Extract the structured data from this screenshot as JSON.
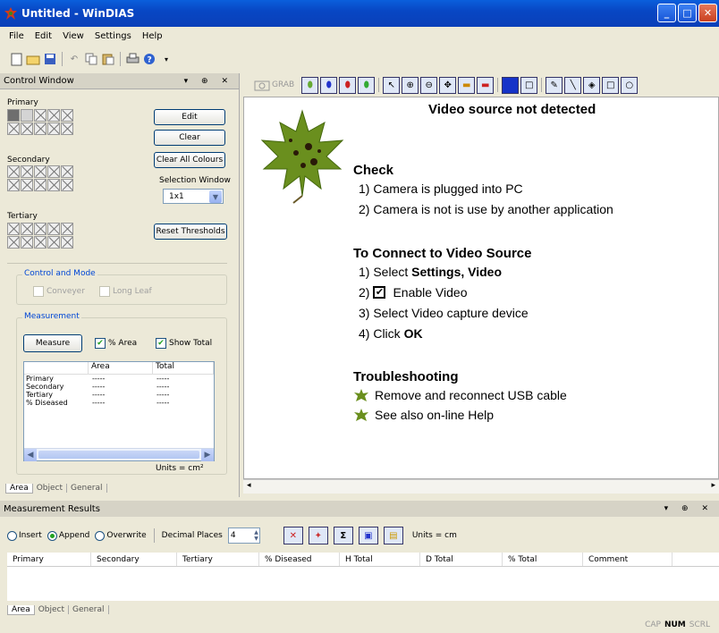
{
  "window": {
    "title": "Untitled - WinDIAS"
  },
  "menu": [
    "File",
    "Edit",
    "View",
    "Settings",
    "Help"
  ],
  "control": {
    "title": "Control Window",
    "primary": "Primary",
    "secondary": "Secondary",
    "tertiary": "Tertiary",
    "edit": "Edit",
    "clear": "Clear",
    "clear_all": "Clear All Colours",
    "selection_window": "Selection Window",
    "selection_value": "1x1",
    "reset": "Reset Thresholds",
    "control_mode": "Control and Mode",
    "conveyer": "Conveyer",
    "long_leaf": "Long Leaf",
    "measurement": "Measurement",
    "measure": "Measure",
    "pct_area": "% Area",
    "show_total": "Show Total",
    "table_headers": [
      "",
      "Area",
      "Total"
    ],
    "table_rows": [
      [
        "Primary",
        "-----",
        "-----"
      ],
      [
        "Secondary",
        "-----",
        "-----"
      ],
      [
        "Tertiary",
        "-----",
        "-----"
      ],
      [
        "% Diseased",
        "-----",
        "-----"
      ]
    ],
    "units": "Units = cm²",
    "tabs": [
      "Area",
      "Object",
      "General"
    ]
  },
  "video": {
    "grab": "GRAB",
    "title": "Video source not detected",
    "check_head": "Check",
    "check1": "1) Camera is plugged into PC",
    "check2": "2) Camera is not is use by another application",
    "connect_head": "To Connect to Video Source",
    "step1_pre": "1) Select ",
    "step1_bold": "Settings, Video",
    "step2_pre": "2) ",
    "step2": "Enable Video",
    "step3": "3)  Select Video capture device",
    "step4_pre": "4)  Click ",
    "step4_bold": "OK",
    "trouble_head": "Troubleshooting",
    "trouble1": "Remove and reconnect USB cable",
    "trouble2": "See also on-line Help"
  },
  "results": {
    "title": "Measurement Results",
    "insert": "Insert",
    "append": "Append",
    "overwrite": "Overwrite",
    "decimal_places": "Decimal Places",
    "decimal_value": "4",
    "units": "Units = cm",
    "columns": [
      "Primary",
      "Secondary",
      "Tertiary",
      "% Diseased",
      "H Total",
      "D Total",
      "% Total",
      "Comment"
    ],
    "tabs": [
      "Area",
      "Object",
      "General"
    ]
  },
  "status": {
    "cap": "CAP",
    "num": "NUM",
    "scrl": "SCRL"
  }
}
